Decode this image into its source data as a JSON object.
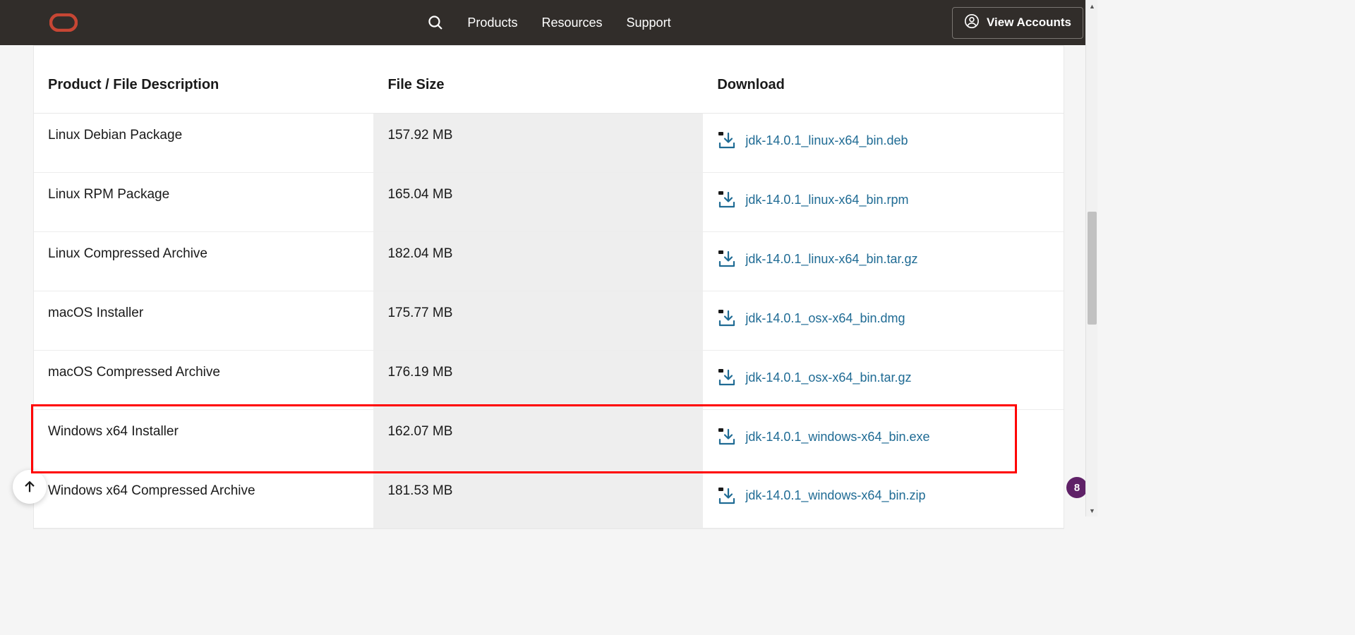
{
  "header": {
    "nav": {
      "products": "Products",
      "resources": "Resources",
      "support": "Support"
    },
    "view_accounts": "View Accounts"
  },
  "table": {
    "headers": {
      "desc": "Product / File Description",
      "size": "File Size",
      "download": "Download"
    },
    "rows": [
      {
        "desc": "Linux Debian Package",
        "size": "157.92 MB",
        "file": "jdk-14.0.1_linux-x64_bin.deb",
        "highlight": false
      },
      {
        "desc": "Linux RPM Package",
        "size": "165.04 MB",
        "file": "jdk-14.0.1_linux-x64_bin.rpm",
        "highlight": false
      },
      {
        "desc": "Linux Compressed Archive",
        "size": "182.04 MB",
        "file": "jdk-14.0.1_linux-x64_bin.tar.gz",
        "highlight": false
      },
      {
        "desc": "macOS Installer",
        "size": "175.77 MB",
        "file": "jdk-14.0.1_osx-x64_bin.dmg",
        "highlight": false
      },
      {
        "desc": "macOS Compressed Archive",
        "size": "176.19 MB",
        "file": "jdk-14.0.1_osx-x64_bin.tar.gz",
        "highlight": false
      },
      {
        "desc": "Windows x64 Installer",
        "size": "162.07 MB",
        "file": "jdk-14.0.1_windows-x64_bin.exe",
        "highlight": true
      },
      {
        "desc": "Windows x64 Compressed Archive",
        "size": "181.53 MB",
        "file": "jdk-14.0.1_windows-x64_bin.zip",
        "highlight": false
      }
    ]
  },
  "badge": "8"
}
